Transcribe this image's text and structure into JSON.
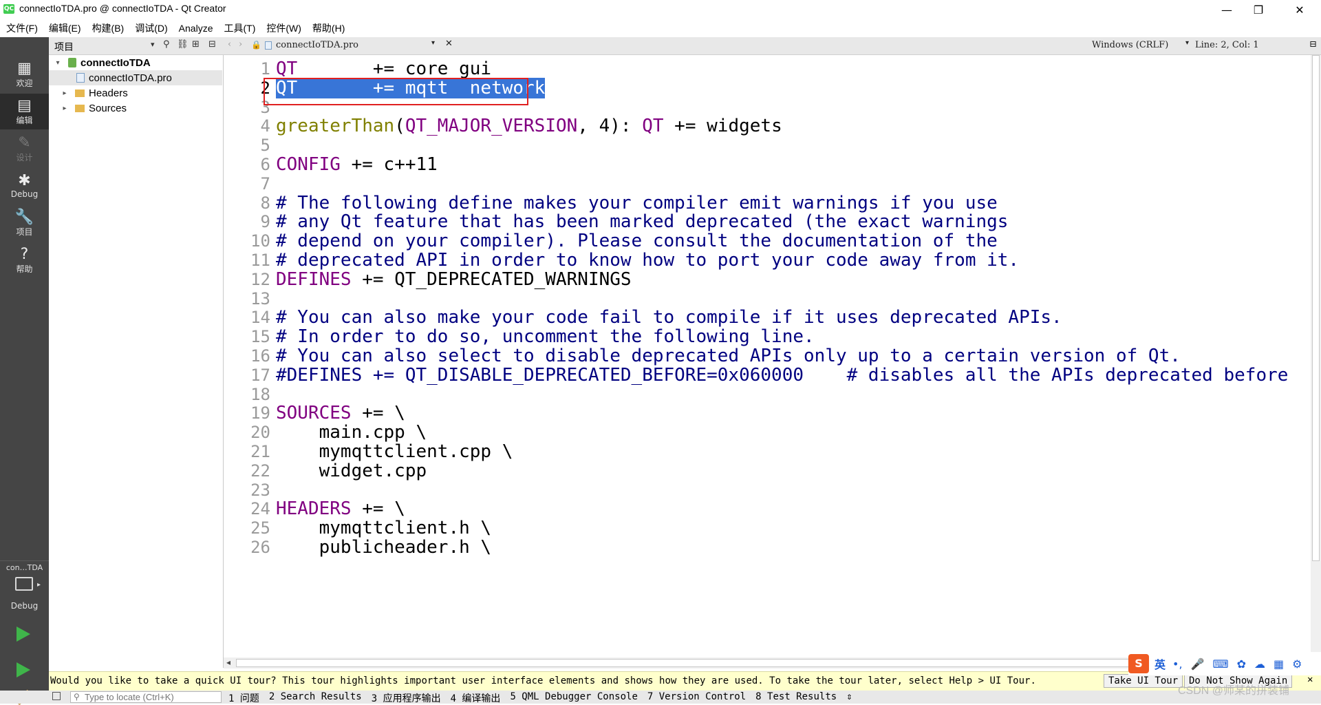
{
  "window": {
    "title": "connectIoTDA.pro @ connectIoTDA - Qt Creator",
    "app_icon": "QC",
    "minimize": "—",
    "maximize": "❐",
    "close": "✕"
  },
  "menu": [
    "文件(F)",
    "编辑(E)",
    "构建(B)",
    "调试(D)",
    "Analyze",
    "工具(T)",
    "控件(W)",
    "帮助(H)"
  ],
  "modes": [
    {
      "label": "欢迎",
      "icon": "grid-icon"
    },
    {
      "label": "编辑",
      "icon": "edit-doc-icon"
    },
    {
      "label": "设计",
      "icon": "pencil-icon"
    },
    {
      "label": "Debug",
      "icon": "bug-icon"
    },
    {
      "label": "项目",
      "icon": "wrench-icon"
    },
    {
      "label": "帮助",
      "icon": "help-icon"
    }
  ],
  "kit": {
    "project": "con…TDA",
    "mode": "Debug"
  },
  "project_pane": {
    "title": "项目",
    "tree": [
      {
        "label": "connectIoTDA",
        "level": 0,
        "expanded": true,
        "icon": "project-icon"
      },
      {
        "label": "connectIoTDA.pro",
        "level": 1,
        "selected": true,
        "icon": "pro-file-icon"
      },
      {
        "label": "Headers",
        "level": 1,
        "expanded": false,
        "icon": "folder-icon"
      },
      {
        "label": "Sources",
        "level": 1,
        "expanded": false,
        "icon": "folder-icon"
      }
    ]
  },
  "editor_toolbar": {
    "file": "connectIoTDA.pro",
    "line_ending": "Windows (CRLF)",
    "position": "Line: 2, Col: 1"
  },
  "editor": {
    "lines": [
      {
        "n": "1",
        "text": "QT       += core gui"
      },
      {
        "n": "2",
        "text": "QT       += mqtt  network",
        "selected": true
      },
      {
        "n": "3",
        "text": ""
      },
      {
        "n": "4",
        "text": "greaterThan(QT_MAJOR_VERSION, 4): QT += widgets"
      },
      {
        "n": "5",
        "text": ""
      },
      {
        "n": "6",
        "text": "CONFIG += c++11"
      },
      {
        "n": "7",
        "text": ""
      },
      {
        "n": "8",
        "text": "# The following define makes your compiler emit warnings if you use"
      },
      {
        "n": "9",
        "text": "# any Qt feature that has been marked deprecated (the exact warnings"
      },
      {
        "n": "10",
        "text": "# depend on your compiler). Please consult the documentation of the"
      },
      {
        "n": "11",
        "text": "# deprecated API in order to know how to port your code away from it."
      },
      {
        "n": "12",
        "text": "DEFINES += QT_DEPRECATED_WARNINGS"
      },
      {
        "n": "13",
        "text": ""
      },
      {
        "n": "14",
        "text": "# You can also make your code fail to compile if it uses deprecated APIs."
      },
      {
        "n": "15",
        "text": "# In order to do so, uncomment the following line."
      },
      {
        "n": "16",
        "text": "# You can also select to disable deprecated APIs only up to a certain version of Qt."
      },
      {
        "n": "17",
        "text": "#DEFINES += QT_DISABLE_DEPRECATED_BEFORE=0x060000    # disables all the APIs deprecated before"
      },
      {
        "n": "18",
        "text": ""
      },
      {
        "n": "19",
        "text": "SOURCES += \\"
      },
      {
        "n": "20",
        "text": "    main.cpp \\"
      },
      {
        "n": "21",
        "text": "    mymqttclient.cpp \\"
      },
      {
        "n": "22",
        "text": "    widget.cpp"
      },
      {
        "n": "23",
        "text": ""
      },
      {
        "n": "24",
        "text": "HEADERS += \\"
      },
      {
        "n": "25",
        "text": "    mymqttclient.h \\"
      },
      {
        "n": "26",
        "text": "    publicheader.h \\"
      }
    ]
  },
  "tour_bar": {
    "message": "Would you like to take a quick UI tour? This tour highlights important user interface elements and shows how they are used. To take the tour later, select Help > UI Tour.",
    "take_tour": "Take UI Tour",
    "dont_show": "Do Not Show Again",
    "close": "✕"
  },
  "ime": {
    "mode": "英"
  },
  "status_bar": {
    "locator_placeholder": "Type to locate (Ctrl+K)",
    "panes": [
      "1 问题",
      "2 Search Results",
      "3 应用程序输出",
      "4 编译输出",
      "5 QML Debugger Console",
      "7 Version Control",
      "8 Test Results"
    ],
    "watermark": "CSDN @师某的拼装铺"
  },
  "colors": {
    "keyword": "#800080",
    "function": "#808000",
    "comment": "#000080",
    "selection": "#3875d7",
    "annotation_box": "#e02020",
    "mode_bar": "#454545"
  }
}
